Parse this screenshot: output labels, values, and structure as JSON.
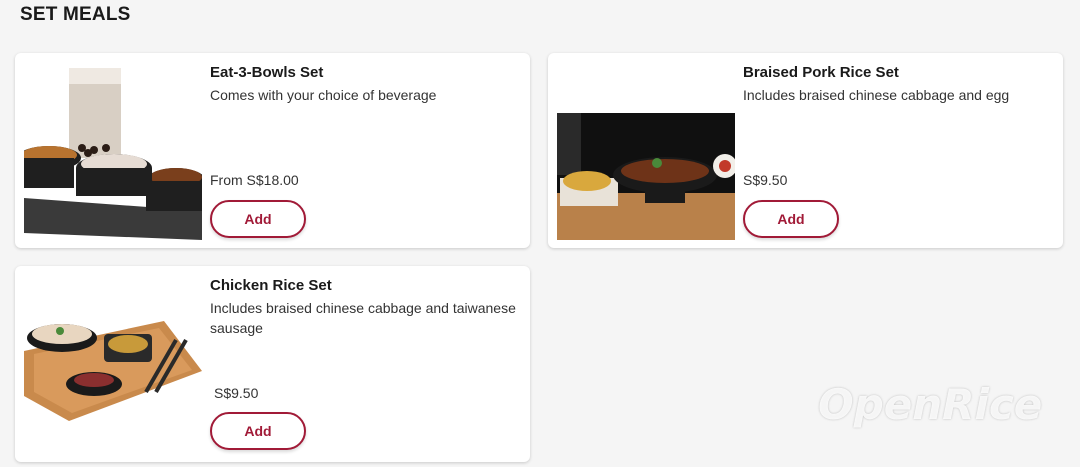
{
  "section": {
    "title": "SET MEALS"
  },
  "items": [
    {
      "name": "Eat-3-Bowls Set",
      "description": "Comes with your choice of beverage",
      "price": "From S$18.00",
      "add_label": "Add"
    },
    {
      "name": "Braised Pork Rice Set",
      "description": "Includes braised chinese cabbage and egg",
      "price": "S$9.50",
      "add_label": "Add"
    },
    {
      "name": "Chicken Rice Set",
      "description": "Includes braised chinese cabbage and taiwanese sausage",
      "price": "S$9.50",
      "add_label": "Add"
    }
  ],
  "watermark": "OpenRice",
  "colors": {
    "accent": "#a11a37",
    "card_bg": "#ffffff",
    "page_bg": "#f5f5f5"
  }
}
